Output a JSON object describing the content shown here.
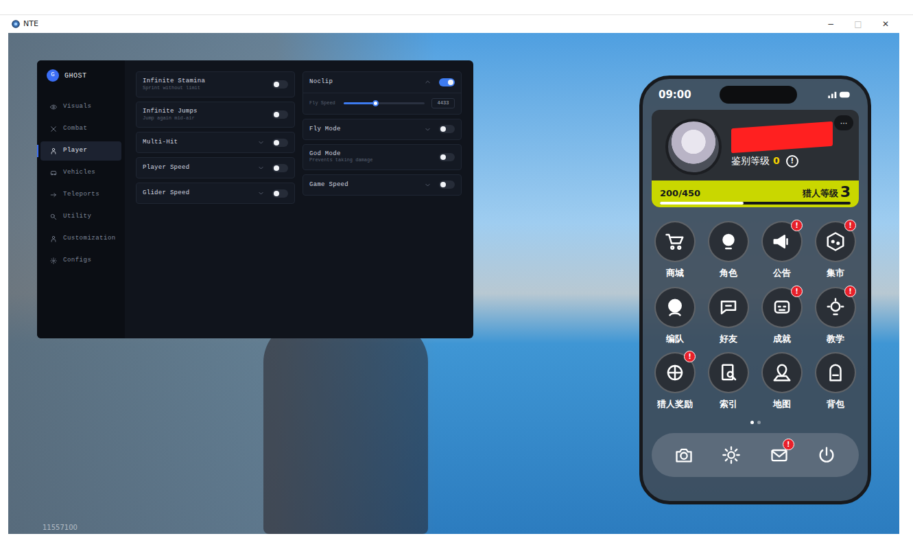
{
  "window": {
    "title": "NTE",
    "controls": [
      "−",
      "□",
      "✕"
    ]
  },
  "menu": {
    "logo": "G",
    "title": "GHOST",
    "sidebar": [
      {
        "label": "Visuals",
        "selected": false
      },
      {
        "label": "Combat",
        "selected": false
      },
      {
        "label": "Player",
        "selected": true
      },
      {
        "label": "Vehicles",
        "selected": false
      },
      {
        "label": "Teleports",
        "selected": false
      },
      {
        "label": "Utility",
        "selected": false
      },
      {
        "label": "Customization",
        "selected": false
      },
      {
        "label": "Configs",
        "selected": false
      }
    ],
    "columns": [
      [
        {
          "kind": "toggle",
          "label": "Infinite Stamina",
          "sub": "Sprint without limit",
          "on": false
        },
        {
          "kind": "toggle",
          "label": "Infinite Jumps",
          "sub": "Jump again mid-air",
          "on": false
        },
        {
          "kind": "dropdown",
          "label": "Multi-Hit",
          "expanded": false,
          "on": false
        },
        {
          "kind": "dropdown",
          "label": "Player Speed",
          "expanded": false,
          "on": false
        },
        {
          "kind": "dropdown",
          "label": "Glider Speed",
          "expanded": false,
          "on": false
        }
      ],
      [
        {
          "kind": "dropdown",
          "label": "Noclip",
          "expanded": true,
          "on": true,
          "slider": {
            "label": "Fly Speed",
            "level": 0.4,
            "value": "4433"
          }
        },
        {
          "kind": "dropdown",
          "label": "Fly Mode",
          "expanded": false,
          "on": false
        },
        {
          "kind": "toggle",
          "label": "God Mode",
          "sub": "Prevents taking damage",
          "on": false
        },
        {
          "kind": "dropdown",
          "label": "Game Speed",
          "expanded": false,
          "on": false
        }
      ]
    ]
  },
  "phone": {
    "time": "09:00",
    "profile": {
      "name_redacted": true,
      "more_glyph": "···",
      "appraisal_label": "鉴别等级",
      "appraisal_level": "0",
      "info_glyph": "!",
      "exp": "200/450",
      "exp_level": 0.44,
      "hunter_label": "猎人等级",
      "hunter_level": "3"
    },
    "alert_glyph": "!",
    "apps": [
      {
        "label": "商城",
        "alert": false
      },
      {
        "label": "角色",
        "alert": false
      },
      {
        "label": "公告",
        "alert": true
      },
      {
        "label": "集市",
        "alert": true
      },
      {
        "label": "编队",
        "alert": false
      },
      {
        "label": "好友",
        "alert": false
      },
      {
        "label": "成就",
        "alert": true
      },
      {
        "label": "教学",
        "alert": true
      },
      {
        "label": "猎人奖励",
        "alert": true
      },
      {
        "label": "索引",
        "alert": false
      },
      {
        "label": "地图",
        "alert": false
      },
      {
        "label": "背包",
        "alert": false
      }
    ],
    "page_dots": [
      {
        "selected": true
      },
      {
        "selected": false
      }
    ],
    "dock": [
      {
        "alert": false
      },
      {
        "alert": false
      },
      {
        "alert": true
      },
      {
        "alert": false
      }
    ]
  },
  "hud": {
    "uid": "11557100"
  }
}
